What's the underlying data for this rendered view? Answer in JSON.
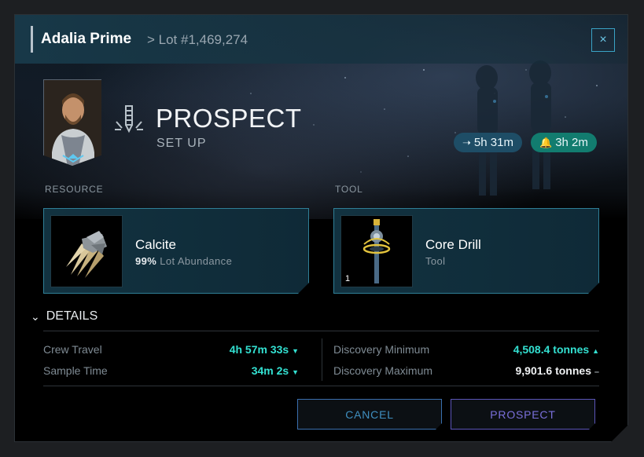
{
  "header": {
    "title": "Adalia Prime",
    "crumb": "> Lot #1,469,274",
    "close_label": "×"
  },
  "action": {
    "title": "PROSPECT",
    "subtitle": "SET UP",
    "icon": "drill-icon"
  },
  "pills": {
    "travel": "5h 31m",
    "duration": "3h 2m"
  },
  "resource": {
    "section_label": "RESOURCE",
    "name": "Calcite",
    "abundance_value": "99%",
    "abundance_label": "Lot Abundance"
  },
  "tool": {
    "section_label": "TOOL",
    "name": "Core Drill",
    "type": "Tool",
    "quantity": "1"
  },
  "details": {
    "heading": "DETAILS",
    "crew_travel_label": "Crew Travel",
    "crew_travel_value": "4h 57m 33s",
    "sample_time_label": "Sample Time",
    "sample_time_value": "34m 2s",
    "discovery_min_label": "Discovery Minimum",
    "discovery_min_value": "4,508.4 tonnes",
    "discovery_max_label": "Discovery Maximum",
    "discovery_max_value": "9,901.6 tonnes"
  },
  "buttons": {
    "cancel": "CANCEL",
    "prospect": "PROSPECT"
  },
  "colors": {
    "accent_teal": "#33e0d1",
    "card_border": "#2f7f97",
    "prospect_button": "#7a6fdb",
    "cancel_button": "#3f8fc0"
  }
}
